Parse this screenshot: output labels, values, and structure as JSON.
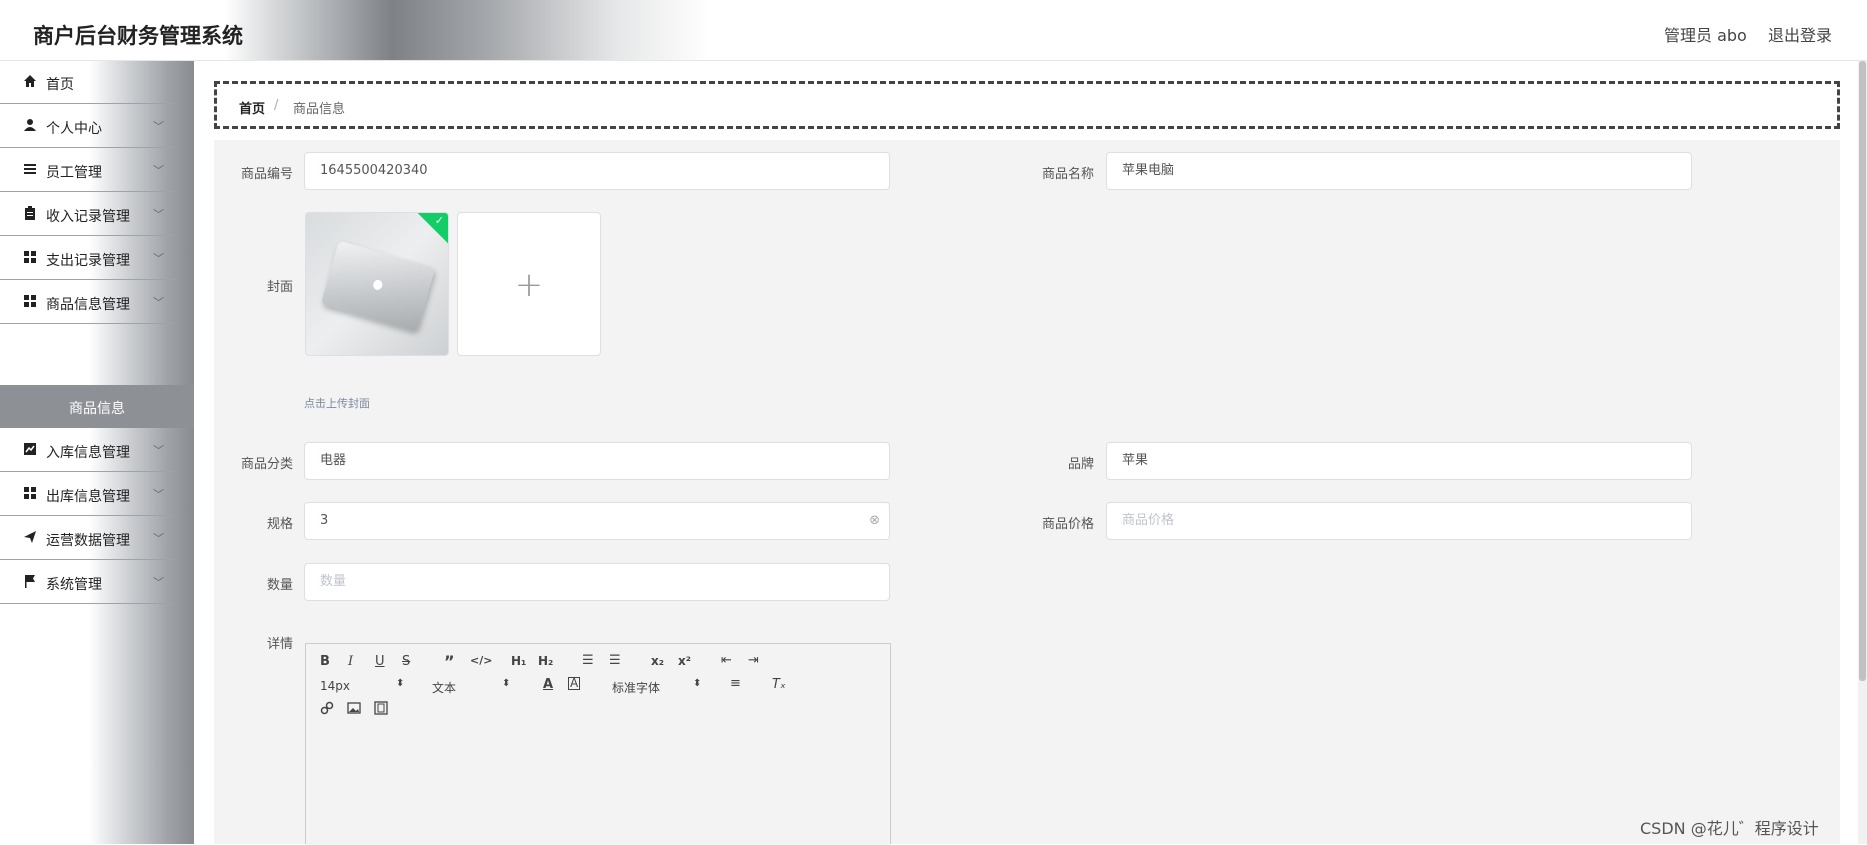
{
  "header": {
    "title": "商户后台财务管理系统",
    "user_label": "管理员 abo",
    "logout_label": "退出登录"
  },
  "sidebar": {
    "items": [
      {
        "label": "首页",
        "icon": "home-icon"
      },
      {
        "label": "个人中心",
        "icon": "user-icon"
      },
      {
        "label": "员工管理",
        "icon": "list-icon"
      },
      {
        "label": "收入记录管理",
        "icon": "clipboard-icon"
      },
      {
        "label": "支出记录管理",
        "icon": "grid-icon"
      },
      {
        "label": "商品信息管理",
        "icon": "grid-icon"
      },
      {
        "label": "入库信息管理",
        "icon": "chart-icon"
      },
      {
        "label": "出库信息管理",
        "icon": "grid-icon"
      },
      {
        "label": "运营数据管理",
        "icon": "send-icon"
      },
      {
        "label": "系统管理",
        "icon": "flag-icon"
      }
    ],
    "active_sub": "商品信息"
  },
  "breadcrumb": {
    "home": "首页",
    "separator": "/",
    "current": "商品信息"
  },
  "form": {
    "product_no": {
      "label": "商品编号",
      "value": "1645500420340"
    },
    "product_name": {
      "label": "商品名称",
      "value": "苹果电脑"
    },
    "cover": {
      "label": "封面",
      "tip": "点击上传封面"
    },
    "category": {
      "label": "商品分类",
      "value": "电器"
    },
    "brand": {
      "label": "品牌",
      "value": "苹果"
    },
    "spec": {
      "label": "规格",
      "value": "3"
    },
    "price": {
      "label": "商品价格",
      "placeholder": "商品价格"
    },
    "quantity": {
      "label": "数量",
      "placeholder": "数量"
    },
    "detail": {
      "label": "详情"
    }
  },
  "editor": {
    "font_size": "14px",
    "block_format": "文本",
    "font_family": "标准字体"
  },
  "watermark": "CSDN @花儿゛程序设计",
  "colors": {
    "success": "#13ce66",
    "sidebar_active": "#8d9196"
  }
}
